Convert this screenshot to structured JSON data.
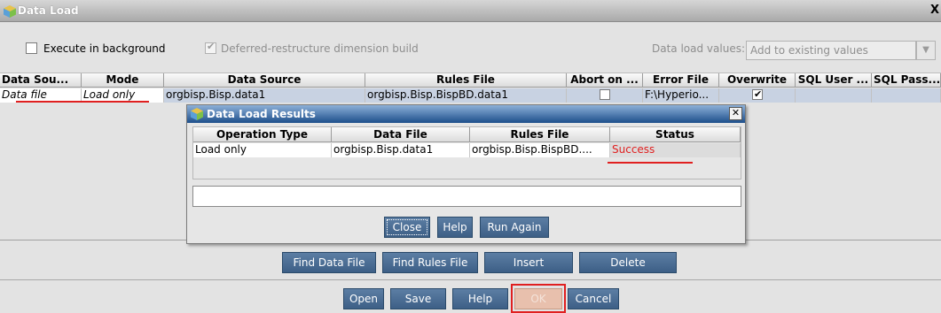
{
  "window": {
    "title": "Data Load",
    "close_glyph": "X"
  },
  "options": {
    "execute_background_label": "Execute in background",
    "execute_background_checked": false,
    "deferred_label": "Deferred-restructure dimension build",
    "deferred_checked": true,
    "data_load_values_label": "Data load values:",
    "data_load_values_selected": "Add to existing values"
  },
  "grid": {
    "columns": [
      "Data Sou...",
      "Mode",
      "Data Source",
      "Rules File",
      "Abort on ...",
      "Error File",
      "Overwrite",
      "SQL User ...",
      "SQL Pass..."
    ],
    "rows": [
      {
        "data_source_type": "Data file",
        "mode": "Load only",
        "data_source": "orgbisp.Bisp.data1",
        "rules_file": "orgbisp.Bisp.BispBD.data1",
        "abort_on_error": false,
        "error_file": "F:\\Hyperio...",
        "overwrite": true,
        "sql_user": "",
        "sql_password": ""
      }
    ]
  },
  "results_dialog": {
    "title": "Data Load Results",
    "close_glyph": "✕",
    "columns": [
      "Operation Type",
      "Data File",
      "Rules File",
      "Status"
    ],
    "rows": [
      {
        "operation_type": "Load only",
        "data_file": "orgbisp.Bisp.data1",
        "rules_file": "orgbisp.Bisp.BispBD....",
        "status": "Success"
      }
    ],
    "message": "",
    "buttons": {
      "close": "Close",
      "help": "Help",
      "run_again": "Run Again"
    }
  },
  "grid_buttons": {
    "find_data_file": "Find Data File",
    "find_rules_file": "Find Rules File",
    "insert": "Insert",
    "delete": "Delete"
  },
  "bottom_buttons": {
    "open": "Open",
    "save": "Save",
    "help": "Help",
    "ok": "OK",
    "cancel": "Cancel"
  },
  "colors": {
    "button_blue": "#4a6d93",
    "highlight_red": "#e02020",
    "dialog_title_blue": "#1d4f8b"
  }
}
